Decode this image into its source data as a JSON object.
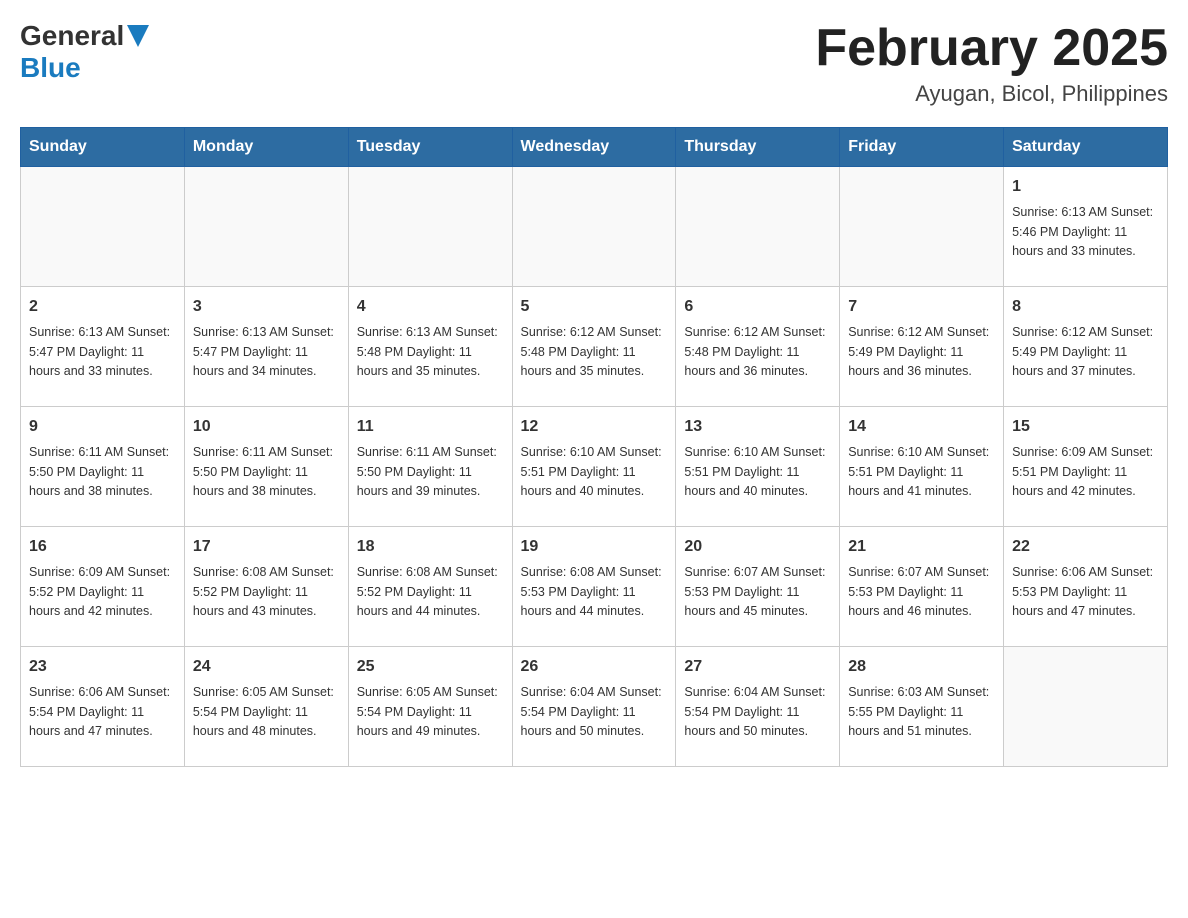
{
  "header": {
    "logo": {
      "general": "General",
      "blue": "Blue"
    },
    "title": "February 2025",
    "location": "Ayugan, Bicol, Philippines"
  },
  "days_of_week": [
    "Sunday",
    "Monday",
    "Tuesday",
    "Wednesday",
    "Thursday",
    "Friday",
    "Saturday"
  ],
  "weeks": [
    [
      {
        "day": "",
        "info": ""
      },
      {
        "day": "",
        "info": ""
      },
      {
        "day": "",
        "info": ""
      },
      {
        "day": "",
        "info": ""
      },
      {
        "day": "",
        "info": ""
      },
      {
        "day": "",
        "info": ""
      },
      {
        "day": "1",
        "info": "Sunrise: 6:13 AM\nSunset: 5:46 PM\nDaylight: 11 hours and 33 minutes."
      }
    ],
    [
      {
        "day": "2",
        "info": "Sunrise: 6:13 AM\nSunset: 5:47 PM\nDaylight: 11 hours and 33 minutes."
      },
      {
        "day": "3",
        "info": "Sunrise: 6:13 AM\nSunset: 5:47 PM\nDaylight: 11 hours and 34 minutes."
      },
      {
        "day": "4",
        "info": "Sunrise: 6:13 AM\nSunset: 5:48 PM\nDaylight: 11 hours and 35 minutes."
      },
      {
        "day": "5",
        "info": "Sunrise: 6:12 AM\nSunset: 5:48 PM\nDaylight: 11 hours and 35 minutes."
      },
      {
        "day": "6",
        "info": "Sunrise: 6:12 AM\nSunset: 5:48 PM\nDaylight: 11 hours and 36 minutes."
      },
      {
        "day": "7",
        "info": "Sunrise: 6:12 AM\nSunset: 5:49 PM\nDaylight: 11 hours and 36 minutes."
      },
      {
        "day": "8",
        "info": "Sunrise: 6:12 AM\nSunset: 5:49 PM\nDaylight: 11 hours and 37 minutes."
      }
    ],
    [
      {
        "day": "9",
        "info": "Sunrise: 6:11 AM\nSunset: 5:50 PM\nDaylight: 11 hours and 38 minutes."
      },
      {
        "day": "10",
        "info": "Sunrise: 6:11 AM\nSunset: 5:50 PM\nDaylight: 11 hours and 38 minutes."
      },
      {
        "day": "11",
        "info": "Sunrise: 6:11 AM\nSunset: 5:50 PM\nDaylight: 11 hours and 39 minutes."
      },
      {
        "day": "12",
        "info": "Sunrise: 6:10 AM\nSunset: 5:51 PM\nDaylight: 11 hours and 40 minutes."
      },
      {
        "day": "13",
        "info": "Sunrise: 6:10 AM\nSunset: 5:51 PM\nDaylight: 11 hours and 40 minutes."
      },
      {
        "day": "14",
        "info": "Sunrise: 6:10 AM\nSunset: 5:51 PM\nDaylight: 11 hours and 41 minutes."
      },
      {
        "day": "15",
        "info": "Sunrise: 6:09 AM\nSunset: 5:51 PM\nDaylight: 11 hours and 42 minutes."
      }
    ],
    [
      {
        "day": "16",
        "info": "Sunrise: 6:09 AM\nSunset: 5:52 PM\nDaylight: 11 hours and 42 minutes."
      },
      {
        "day": "17",
        "info": "Sunrise: 6:08 AM\nSunset: 5:52 PM\nDaylight: 11 hours and 43 minutes."
      },
      {
        "day": "18",
        "info": "Sunrise: 6:08 AM\nSunset: 5:52 PM\nDaylight: 11 hours and 44 minutes."
      },
      {
        "day": "19",
        "info": "Sunrise: 6:08 AM\nSunset: 5:53 PM\nDaylight: 11 hours and 44 minutes."
      },
      {
        "day": "20",
        "info": "Sunrise: 6:07 AM\nSunset: 5:53 PM\nDaylight: 11 hours and 45 minutes."
      },
      {
        "day": "21",
        "info": "Sunrise: 6:07 AM\nSunset: 5:53 PM\nDaylight: 11 hours and 46 minutes."
      },
      {
        "day": "22",
        "info": "Sunrise: 6:06 AM\nSunset: 5:53 PM\nDaylight: 11 hours and 47 minutes."
      }
    ],
    [
      {
        "day": "23",
        "info": "Sunrise: 6:06 AM\nSunset: 5:54 PM\nDaylight: 11 hours and 47 minutes."
      },
      {
        "day": "24",
        "info": "Sunrise: 6:05 AM\nSunset: 5:54 PM\nDaylight: 11 hours and 48 minutes."
      },
      {
        "day": "25",
        "info": "Sunrise: 6:05 AM\nSunset: 5:54 PM\nDaylight: 11 hours and 49 minutes."
      },
      {
        "day": "26",
        "info": "Sunrise: 6:04 AM\nSunset: 5:54 PM\nDaylight: 11 hours and 50 minutes."
      },
      {
        "day": "27",
        "info": "Sunrise: 6:04 AM\nSunset: 5:54 PM\nDaylight: 11 hours and 50 minutes."
      },
      {
        "day": "28",
        "info": "Sunrise: 6:03 AM\nSunset: 5:55 PM\nDaylight: 11 hours and 51 minutes."
      },
      {
        "day": "",
        "info": ""
      }
    ]
  ]
}
